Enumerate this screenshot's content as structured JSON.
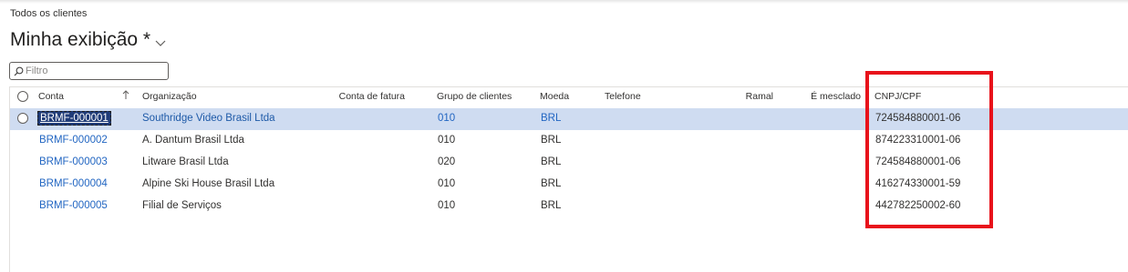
{
  "breadcrumb": "Todos os clientes",
  "view": {
    "title": "Minha exibição *",
    "chevron_icon": "chevron-down-icon"
  },
  "filter": {
    "placeholder": "Filtro",
    "value": "",
    "icon": "search-icon"
  },
  "columns": {
    "conta": "Conta",
    "organizacao": "Organização",
    "conta_fatura": "Conta de fatura",
    "grupo": "Grupo de clientes",
    "moeda": "Moeda",
    "telefone": "Telefone",
    "ramal": "Ramal",
    "mesclado": "É mesclado",
    "cnpj": "CNPJ/CPF"
  },
  "rows": [
    {
      "conta": "BRMF-000001",
      "organizacao": "Southridge Video Brasil Ltda",
      "grupo": "010",
      "moeda": "BRL",
      "cnpj": "724584880001-06",
      "selected": true
    },
    {
      "conta": "BRMF-000002",
      "organizacao": "A. Dantum Brasil Ltda",
      "grupo": "010",
      "moeda": "BRL",
      "cnpj": "874223310001-06",
      "selected": false
    },
    {
      "conta": "BRMF-000003",
      "organizacao": "Litware Brasil Ltda",
      "grupo": "020",
      "moeda": "BRL",
      "cnpj": "724584880001-06",
      "selected": false
    },
    {
      "conta": "BRMF-000004",
      "organizacao": "Alpine Ski House Brasil Ltda",
      "grupo": "010",
      "moeda": "BRL",
      "cnpj": "416274330001-59",
      "selected": false
    },
    {
      "conta": "BRMF-000005",
      "organizacao": "Filial de Serviços",
      "grupo": "010",
      "moeda": "BRL",
      "cnpj": "442782250002-60",
      "selected": false
    }
  ],
  "colors": {
    "link": "#2266c2",
    "selected_row": "#cfdcf1",
    "highlight": "#e8121b"
  }
}
